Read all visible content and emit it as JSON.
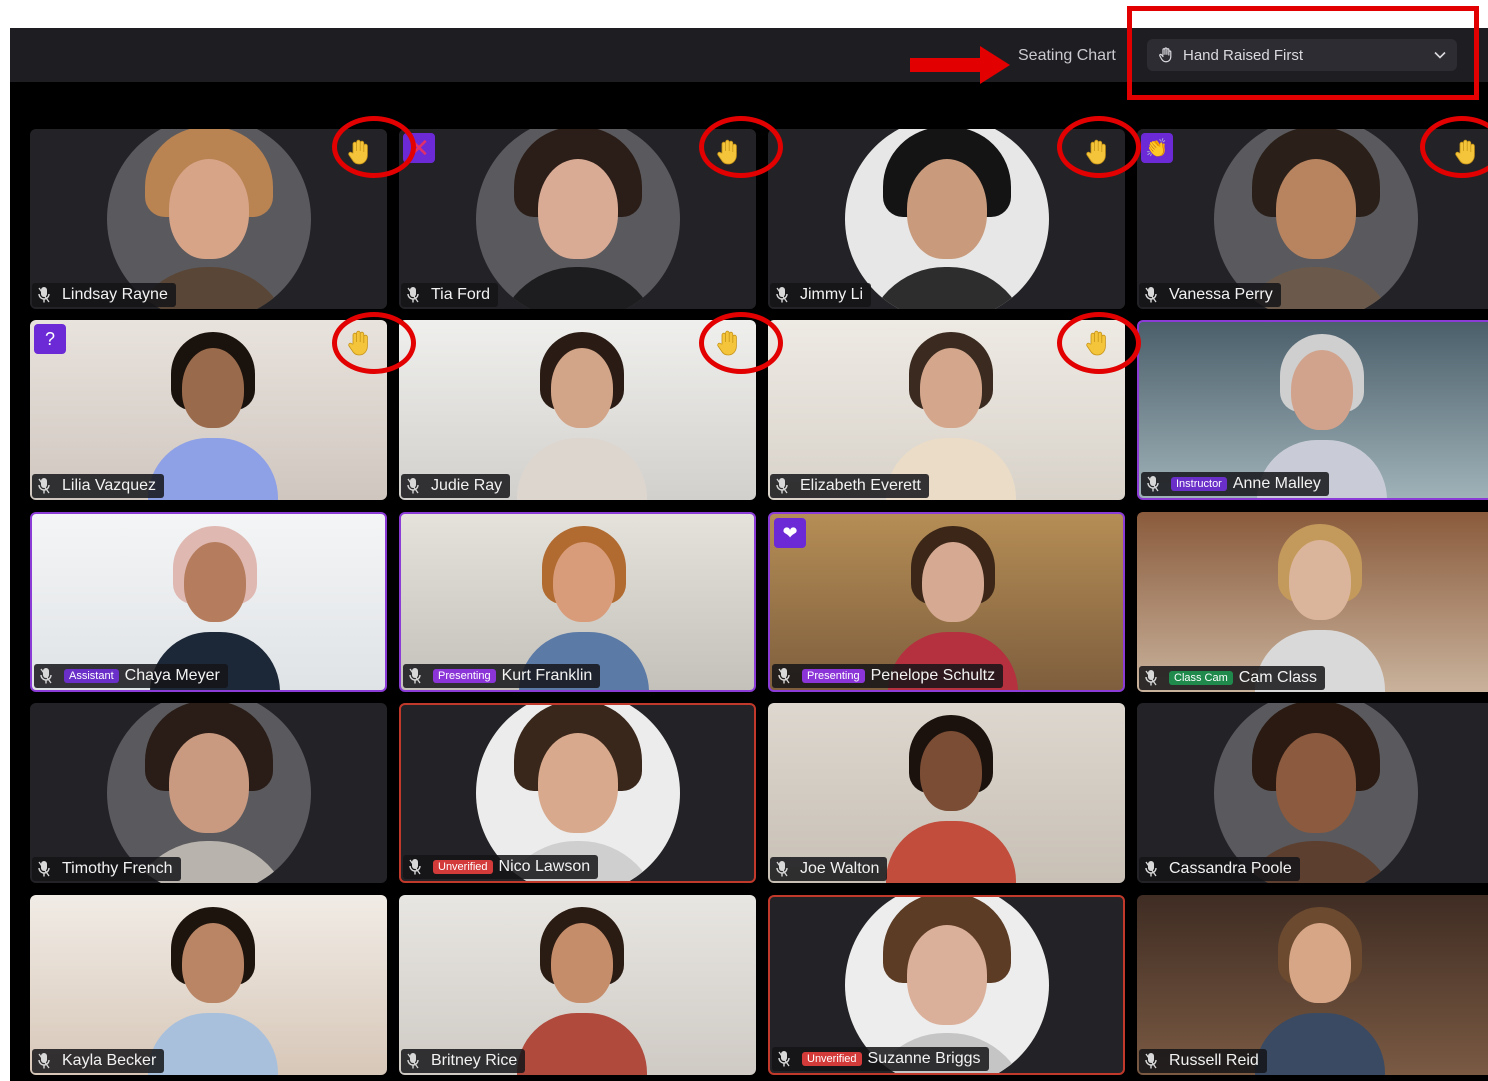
{
  "toolbar": {
    "seating_label": "Seating Chart",
    "sort": {
      "value": "Hand Raised First"
    }
  },
  "participants": [
    {
      "name": "Lindsay Rayne",
      "hand_raised": true
    },
    {
      "name": "Tia Ford",
      "hand_raised": true,
      "reaction": "✕"
    },
    {
      "name": "Jimmy Li",
      "hand_raised": true
    },
    {
      "name": "Vanessa Perry",
      "hand_raised": true,
      "reaction": "👏"
    },
    {
      "name": "Lilia Vazquez",
      "hand_raised": true,
      "reaction": "?"
    },
    {
      "name": "Judie Ray",
      "hand_raised": true
    },
    {
      "name": "Elizabeth Everett",
      "hand_raised": true
    },
    {
      "name": "Anne Malley",
      "badge": "Instructor"
    },
    {
      "name": "Chaya Meyer",
      "badge": "Assistant"
    },
    {
      "name": "Kurt Franklin",
      "badge": "Presenting"
    },
    {
      "name": "Penelope Schultz",
      "badge": "Presenting",
      "reaction": "❤"
    },
    {
      "name": "Cam Class",
      "badge": "Class Cam"
    },
    {
      "name": "Timothy French"
    },
    {
      "name": "Nico Lawson",
      "badge": "Unverified"
    },
    {
      "name": "Joe Walton"
    },
    {
      "name": "Cassandra Poole"
    },
    {
      "name": "Kayla Becker"
    },
    {
      "name": "Britney Rice"
    },
    {
      "name": "Suzanne Briggs",
      "badge": "Unverified"
    },
    {
      "name": "Russell Reid"
    }
  ],
  "colors": {
    "accent_purple": "#8b3bd6",
    "alert_red": "#e20000",
    "hand_yellow": "#f4c53a"
  },
  "icons": [
    "mic-icon",
    "raised-hand-icon",
    "chevron-down-icon",
    "hand-icon"
  ]
}
